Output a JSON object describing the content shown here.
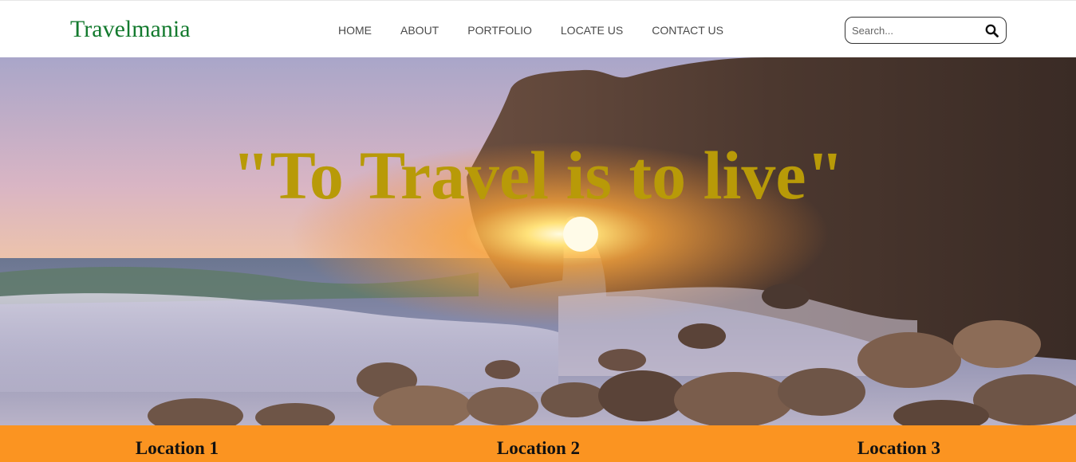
{
  "navbar": {
    "brand": "Travelmania",
    "links": [
      {
        "label": "HOME"
      },
      {
        "label": "ABOUT"
      },
      {
        "label": "PORTFOLIO"
      },
      {
        "label": "LOCATE US"
      },
      {
        "label": "CONTACT US"
      }
    ],
    "search": {
      "placeholder": "Search...",
      "value": "",
      "icon": "search-icon"
    }
  },
  "hero": {
    "quote": "\"To Travel is to live\"",
    "quote_color": "#b89a08",
    "image": "sunset-sea-arch-rocks"
  },
  "locations": {
    "background": "#fb9421",
    "items": [
      {
        "label": "Location 1"
      },
      {
        "label": "Location 2"
      },
      {
        "label": "Location 3"
      }
    ]
  },
  "colors": {
    "brand": "#137a2e",
    "nav_text": "#4a4a4a"
  }
}
